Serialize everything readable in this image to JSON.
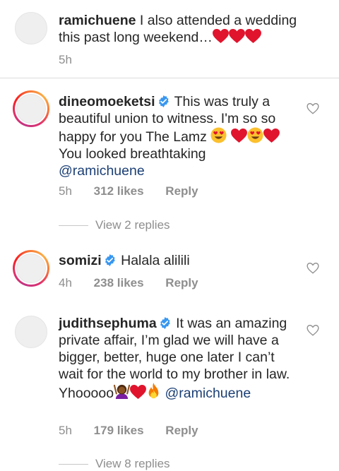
{
  "comments": [
    {
      "username": "ramichuene",
      "text": "I also attended a wedding this past  long weekend…",
      "time": "5h"
    },
    {
      "username": "dineomoeketsi",
      "text_a": "This was truly a beautiful union to witness. I'm so so happy for you The Lamz",
      "text_b": "You looked breathtaking",
      "mention": "@ramichuene",
      "time": "5h",
      "likes": "312 likes",
      "reply": "Reply",
      "view_replies": "View 2 replies"
    },
    {
      "username": "somizi",
      "text": "Halala alilili",
      "time": "4h",
      "likes": "238 likes",
      "reply": "Reply"
    },
    {
      "username": "judithsephuma",
      "text": "It was an amazing private affair, I’m glad we will have a bigger, better, huge one later I can’t wait for the world to my brother in law. Yhooooo",
      "mention": "@ramichuene",
      "time": "5h",
      "likes": "179 likes",
      "reply": "Reply",
      "view_replies": "View 8 replies"
    }
  ],
  "icons": {
    "heart_outline": "heart-outline-icon",
    "verified": "verified-badge-icon",
    "emoji_heart": "red-heart-emoji",
    "emoji_heart_eyes": "heart-eyes-emoji",
    "emoji_woman_gesturing": "woman-gesturing-emoji",
    "emoji_fire": "fire-emoji"
  },
  "colors": {
    "mention": "#1b3f75",
    "meta": "#8e8e8e",
    "heart": "#e0142d",
    "verified": "#3897f0"
  }
}
